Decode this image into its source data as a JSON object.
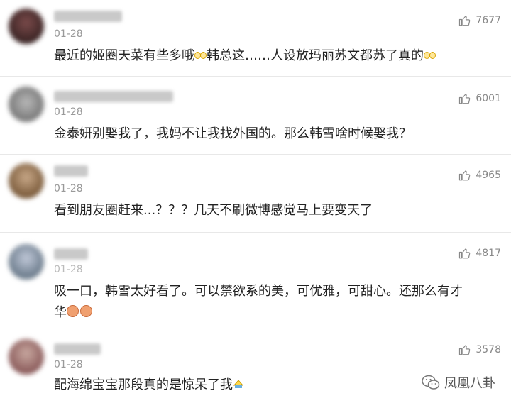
{
  "comments": [
    {
      "date": "01-28",
      "likes": "7677",
      "text_parts": [
        "最近的姬圈天菜有些多哦",
        "韩总这……人设放玛丽苏文都苏了真的"
      ],
      "avatar_color": "#5a3a3a"
    },
    {
      "date": "01-28",
      "likes": "6001",
      "text": "金泰妍别娶我了，我妈不让我找外国的。那么韩雪啥时候娶我？",
      "avatar_color": "#8a8a8a"
    },
    {
      "date": "01-28",
      "likes": "4965",
      "text": "看到朋友圈赶来...？？？几天不刷微博感觉马上要变天了",
      "avatar_color": "#9a7a5a"
    },
    {
      "date": "01-28",
      "likes": "4817",
      "text_line1": "吸一口，韩雪太好看了。可以禁欲系的美，可优雅，可甜心。还那么有才",
      "text_line2": "华",
      "avatar_color": "#7a8a9a"
    },
    {
      "date": "01-28",
      "likes": "3578",
      "text": "配海绵宝宝那段真的是惊呆了我",
      "avatar_color": "#8a6a6a"
    }
  ],
  "watermark": {
    "label": "凤凰八卦"
  },
  "colors": {
    "like_icon": "#888888",
    "date": "#999999",
    "text": "#222222"
  }
}
